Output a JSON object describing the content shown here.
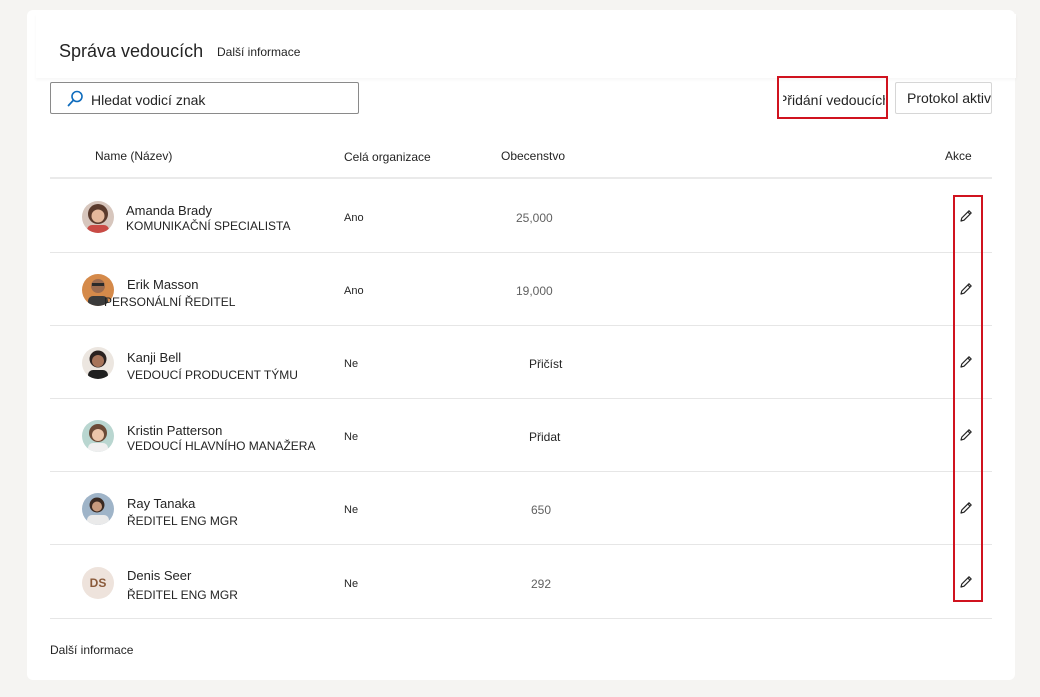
{
  "header": {
    "title": "Správa vedoucích",
    "more_info_link": "Další informace"
  },
  "search": {
    "placeholder": "Hledat vodicí znak"
  },
  "toolbar": {
    "add_button": "Přidání vedoucích",
    "log_button": "Protokol aktivit"
  },
  "table": {
    "columns": {
      "name": "Name (Název)",
      "org": "Celá organizace",
      "audience": "Obecenstvo",
      "actions": "Akce"
    },
    "rows": [
      {
        "name": "Amanda Brady",
        "title": "KOMUNIKAČNÍ SPECIALISTA",
        "org": "Ano",
        "audience": "25,000",
        "avatar": "photo"
      },
      {
        "name": "Erik Masson",
        "title": "PERSONÁLNÍ ŘEDITEL",
        "org": "Ano",
        "audience": "19,000",
        "avatar": "photo"
      },
      {
        "name": "Kanji Bell",
        "title": "VEDOUCÍ PRODUCENT TÝMU",
        "org": "Ne",
        "audience": "Přičíst",
        "avatar": "photo"
      },
      {
        "name": "Kristin Patterson",
        "title": "VEDOUCÍ HLAVNÍHO MANAŽERA",
        "org": "Ne",
        "audience": "Přidat",
        "avatar": "photo"
      },
      {
        "name": "Ray Tanaka",
        "title": "ŘEDITEL ENG MGR",
        "org": "Ne",
        "audience": "650",
        "avatar": "photo"
      },
      {
        "name": "Denis Seer",
        "title": "ŘEDITEL ENG MGR",
        "org": "Ne",
        "audience": "292",
        "avatar": "initials",
        "initials": "DS"
      }
    ]
  },
  "footer": {
    "more_info_link": "Další informace"
  },
  "icons": {
    "search": "search-icon",
    "edit": "pencil-icon"
  },
  "colors": {
    "highlight": "#d0131f",
    "search_icon": "#0f6cbd",
    "initials_bg": "#eee3dc"
  }
}
